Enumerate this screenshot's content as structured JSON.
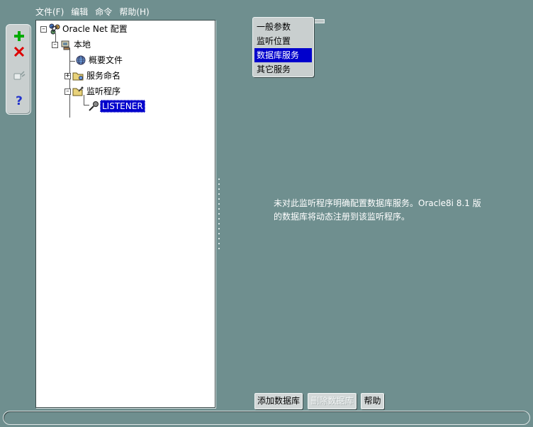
{
  "menubar": {
    "items": [
      "文件(F)",
      "编辑",
      "命令",
      "帮助(H)"
    ]
  },
  "toolbar": {
    "buttons": [
      {
        "icon": "plus-icon",
        "color": "#00aa00"
      },
      {
        "icon": "delete-x-icon",
        "color": "#dd0000"
      },
      {
        "icon": "test-connection-icon"
      },
      {
        "icon": "help-question-icon",
        "color": "#2233cc"
      }
    ]
  },
  "tree": {
    "root": "Oracle Net 配置",
    "local": "本地",
    "profile": "概要文件",
    "service_naming": "服务命名",
    "listeners": "监听程序",
    "listener": "LISTENER"
  },
  "category_list": {
    "items": [
      "一般参数",
      "监听位置",
      "数据库服务",
      "其它服务"
    ],
    "selected": "数据库服务"
  },
  "message": {
    "line1": "未对此监听程序明确配置数据库服务。Oracle8i 8.1 版",
    "line2": "的数据库将动态注册到该监听程序。"
  },
  "buttons": {
    "add_db": "添加数据库",
    "delete_db": "删除数据库",
    "help": "帮助"
  },
  "colors": {
    "background": "#6f8f8f",
    "selection": "#0000cc",
    "panel": "#ffffff"
  }
}
